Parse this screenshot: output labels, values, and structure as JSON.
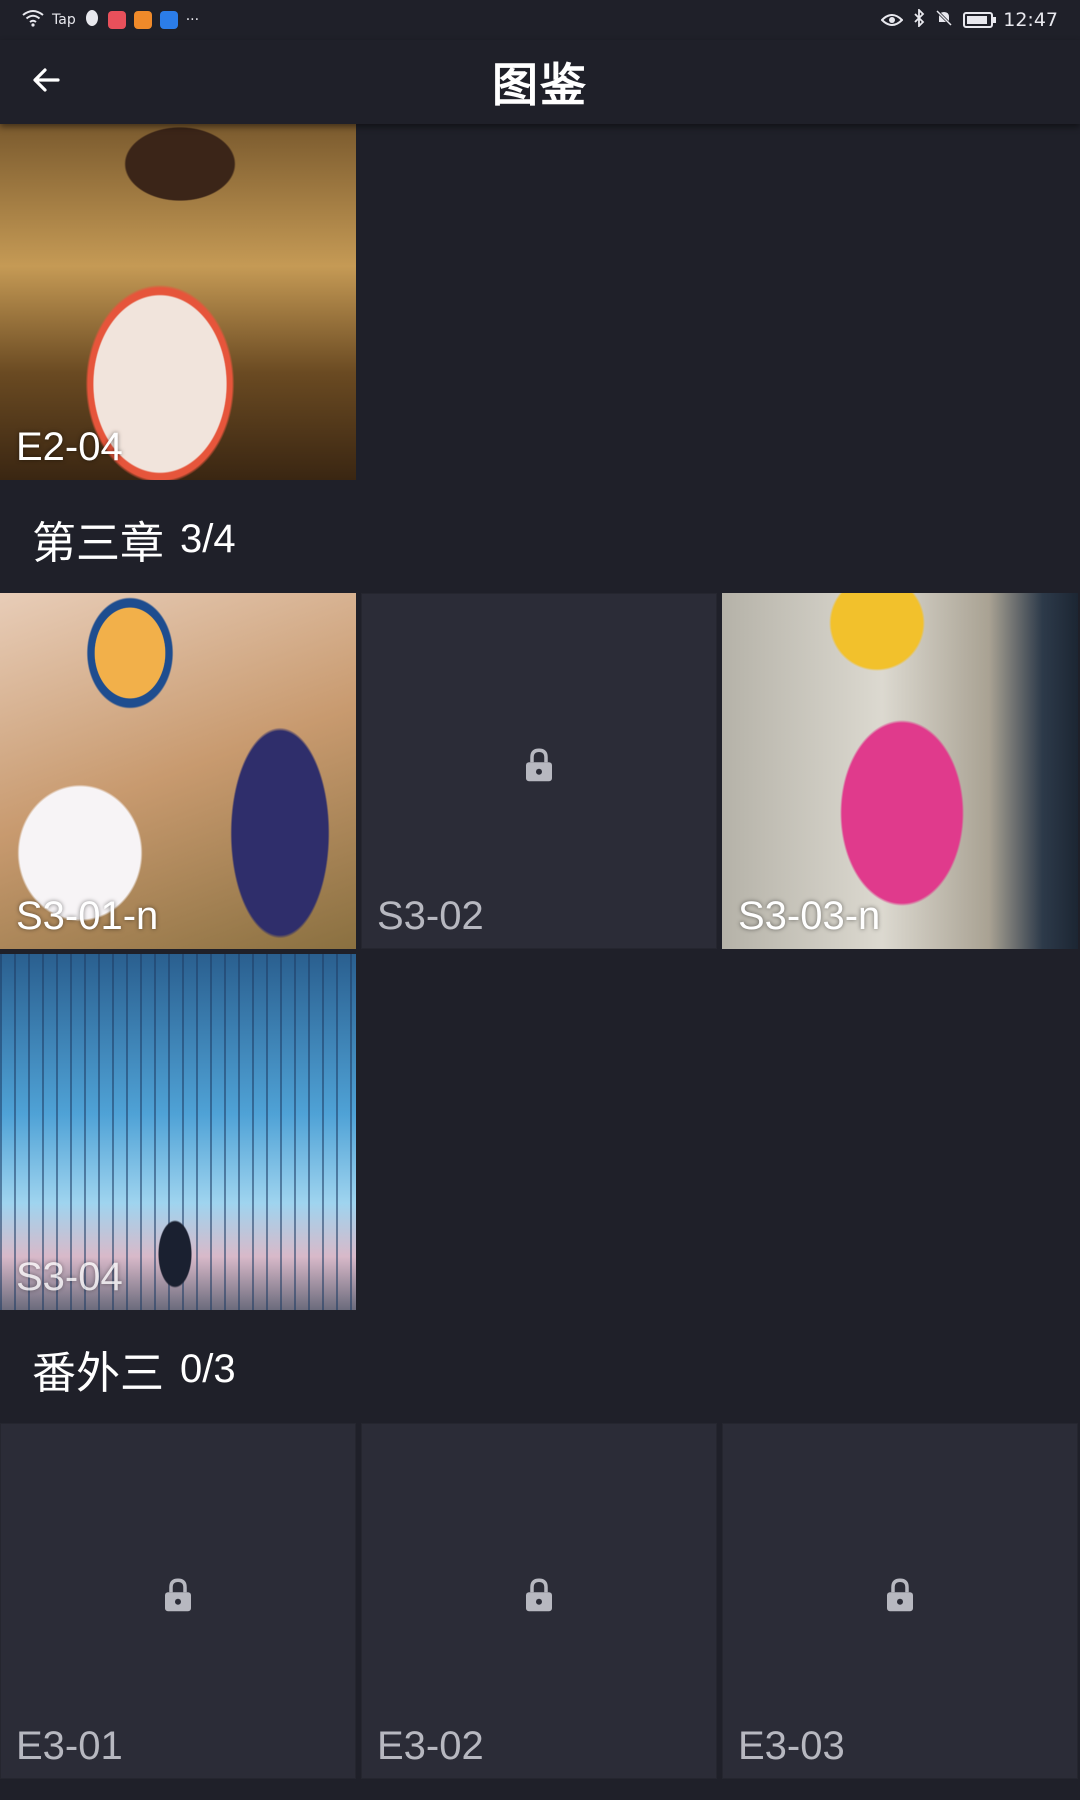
{
  "status_bar": {
    "carrier_tag": "Tap",
    "more": "···",
    "time": "12:47",
    "app_colors": [
      "#e8505b",
      "#f08a2a",
      "#2b7de9"
    ]
  },
  "header": {
    "title": "图鉴"
  },
  "top_tile": {
    "label": "E2-04"
  },
  "sections": [
    {
      "title": "第三章",
      "count": "3/4",
      "tiles": [
        {
          "label": "S3-01-n",
          "locked": false
        },
        {
          "label": "S3-02",
          "locked": true
        },
        {
          "label": "S3-03-n",
          "locked": false
        },
        {
          "label": "S3-04",
          "locked": false
        }
      ]
    },
    {
      "title": "番外三",
      "count": "0/3",
      "tiles": [
        {
          "label": "E3-01",
          "locked": true
        },
        {
          "label": "E3-02",
          "locked": true
        },
        {
          "label": "E3-03",
          "locked": true
        }
      ]
    }
  ]
}
